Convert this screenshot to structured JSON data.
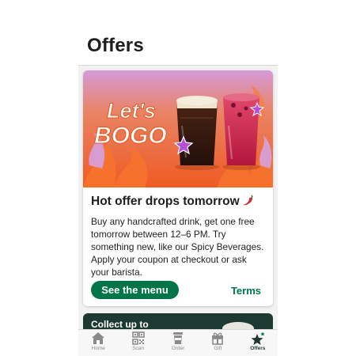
{
  "header": {
    "title": "Offers"
  },
  "offer": {
    "hero_text_line1": "Let's",
    "hero_text_line2": "BOGO",
    "title": "Hot offer drops tomorrow",
    "title_icon": "chili-pepper-icon",
    "description": "Buy any handcrafted drink, get one free tomorrow between 12–6 PM. Try something new, like our Spicy Beverages. Apply your coupon at checkout or ask your barista.",
    "cta_label": "See the menu",
    "terms_label": "Terms"
  },
  "next_card": {
    "title": "Collect up to"
  },
  "tabbar": {
    "items": [
      {
        "label": "Home",
        "icon": "home-icon"
      },
      {
        "label": "Scan",
        "icon": "qr-code-icon"
      },
      {
        "label": "Order",
        "icon": "cup-icon"
      },
      {
        "label": "Gift",
        "icon": "gift-icon"
      },
      {
        "label": "Offers",
        "icon": "star-icon",
        "active": true
      }
    ]
  },
  "colors": {
    "brand_green": "#00754a",
    "house_green": "#1e3932",
    "hero_orange": "#f0622a",
    "hero_purple": "#d291d8"
  }
}
